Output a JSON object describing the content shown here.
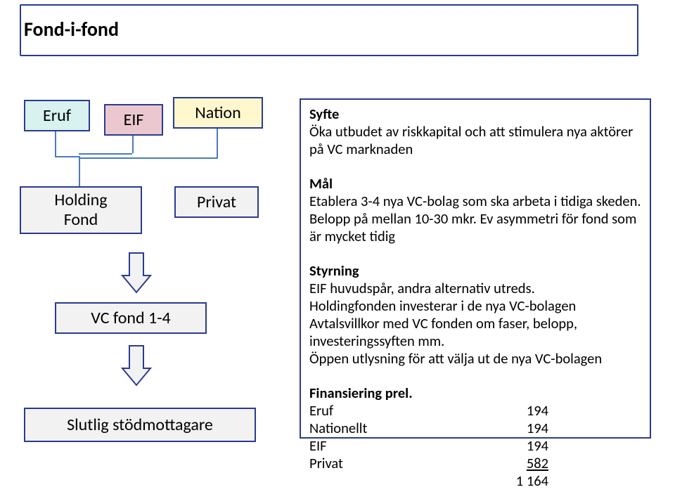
{
  "title": "Fond-i-fond",
  "boxes": {
    "eruf": "Eruf",
    "eif": "EIF",
    "nation": "Nation",
    "privat": "Privat",
    "holding_line1": "Holding",
    "holding_line2": "Fond",
    "vcfond": "VC fond 1-4",
    "slutlig": "Slutlig stödmottagare"
  },
  "info": {
    "syfte_hdr": "Syfte",
    "syfte_body": "Öka utbudet av riskkapital och att stimulera nya aktörer på VC marknaden",
    "mal_hdr": "Mål",
    "mal_body": "Etablera 3-4 nya VC-bolag som ska arbeta i tidiga skeden. Belopp på mellan 10-30 mkr. Ev asymmetri för fond som är mycket tidig",
    "styr_hdr": "Styrning",
    "styr_l1": "EIF huvudspår, andra alternativ utreds.",
    "styr_l2": "Holdingfonden investerar i de nya VC-bolagen",
    "styr_l3": "Avtalsvillkor med VC fonden om faser, belopp, investeringssyften mm.",
    "styr_l4": "Öppen utlysning för att välja ut de nya VC-bolagen",
    "fin_hdr": "Finansiering prel.",
    "fin_rows": {
      "r1_label": "Eruf",
      "r1_value": "194",
      "r2_label": "Nationellt",
      "r2_value": "194",
      "r3_label": "EIF",
      "r3_value": "194",
      "r4_label": "Privat",
      "r4_value": "582",
      "total_value": "1 164"
    }
  }
}
